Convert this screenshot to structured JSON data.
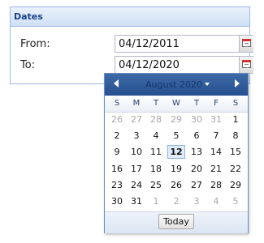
{
  "fieldset": {
    "title": "Dates",
    "from": {
      "label": "From:",
      "value": "04/12/2011"
    },
    "to": {
      "label": "To:",
      "value": "04/12/2020"
    }
  },
  "datepicker": {
    "month_label": "August 2020",
    "weekdays": [
      "S",
      "M",
      "T",
      "W",
      "T",
      "F",
      "S"
    ],
    "weeks": [
      [
        "26",
        "27",
        "28",
        "29",
        "30",
        "31",
        "1"
      ],
      [
        "2",
        "3",
        "4",
        "5",
        "6",
        "7",
        "8"
      ],
      [
        "9",
        "10",
        "11",
        "12",
        "13",
        "14",
        "15"
      ],
      [
        "16",
        "17",
        "18",
        "19",
        "20",
        "21",
        "22"
      ],
      [
        "23",
        "24",
        "25",
        "26",
        "27",
        "28",
        "29"
      ],
      [
        "30",
        "31",
        "1",
        "2",
        "3",
        "4",
        "5"
      ]
    ],
    "selected_day": "12",
    "today_label": "Today"
  }
}
